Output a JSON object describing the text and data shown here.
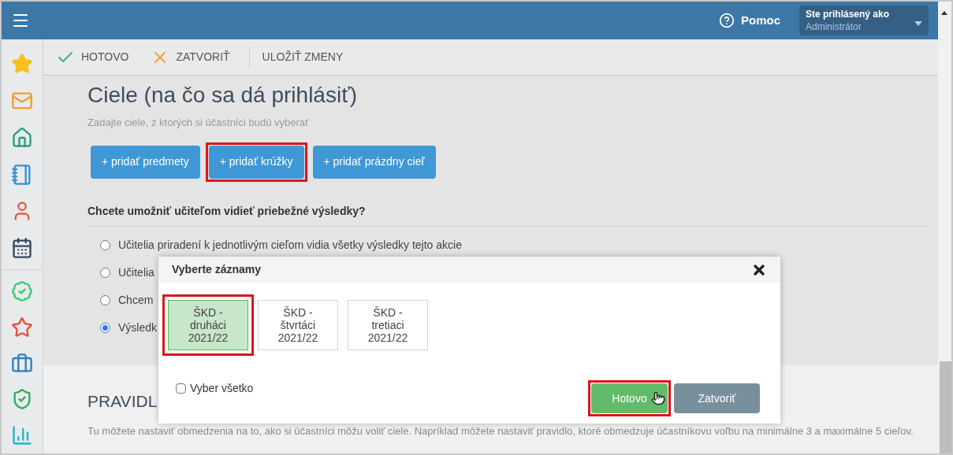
{
  "header": {
    "help": "Pomoc",
    "user_label": "Ste prihlásený ako",
    "user_name": "Administrátor"
  },
  "toolbar": [
    {
      "kind": "done",
      "label": "HOTOVO"
    },
    {
      "kind": "close",
      "label": "ZATVORIŤ"
    },
    {
      "kind": "save",
      "label": "ULOŽIŤ ZMENY"
    }
  ],
  "page": {
    "title": "Ciele (na čo sa dá prihlásiť)",
    "subtitle": "Zadajte ciele, z ktorých si účastníci budú vyberať",
    "add_buttons": [
      {
        "label": "+ pridať predmety",
        "highlighted": false
      },
      {
        "label": "+ pridať krúžky",
        "highlighted": true
      },
      {
        "label": "+ pridať prázdny cieľ",
        "highlighted": false
      }
    ]
  },
  "question": {
    "label": "Chcete umožniť učiteľom vidieť priebežné výsledky?",
    "options": [
      {
        "label": "Učitelia priradení k jednotlivým cieľom vidia všetky výsledky tejto akcie",
        "selected": false
      },
      {
        "label": "Učitelia",
        "selected": false
      },
      {
        "label": "Chcem",
        "selected": false
      },
      {
        "label": "Výsledk",
        "selected": true
      }
    ]
  },
  "rules": {
    "heading": "PRAVIDL",
    "text": "Tu môžete nastaviť obmedzenia na to, ako si účastníci môžu voliť ciele. Napríklad môžete nastaviť pravidlo, ktoré obmedzuje účastníkovu voľbu na minimálne 3 a maximálne 5 cieľov."
  },
  "modal": {
    "title": "Vyberte záznamy",
    "items": [
      {
        "label": "ŠKD - druháci 2021/22",
        "selected": true,
        "highlighted": true
      },
      {
        "label": "ŠKD - štvrtáci 2021/22",
        "selected": false,
        "highlighted": false
      },
      {
        "label": "ŠKD - tretiaci 2021/22",
        "selected": false,
        "highlighted": false
      }
    ],
    "select_all": {
      "label": "Vyber všetko",
      "checked": false
    },
    "buttons": [
      {
        "kind": "primary",
        "label": "Hotovo",
        "highlighted": true
      },
      {
        "kind": "secondary",
        "label": "Zatvoriť",
        "highlighted": false
      }
    ]
  }
}
